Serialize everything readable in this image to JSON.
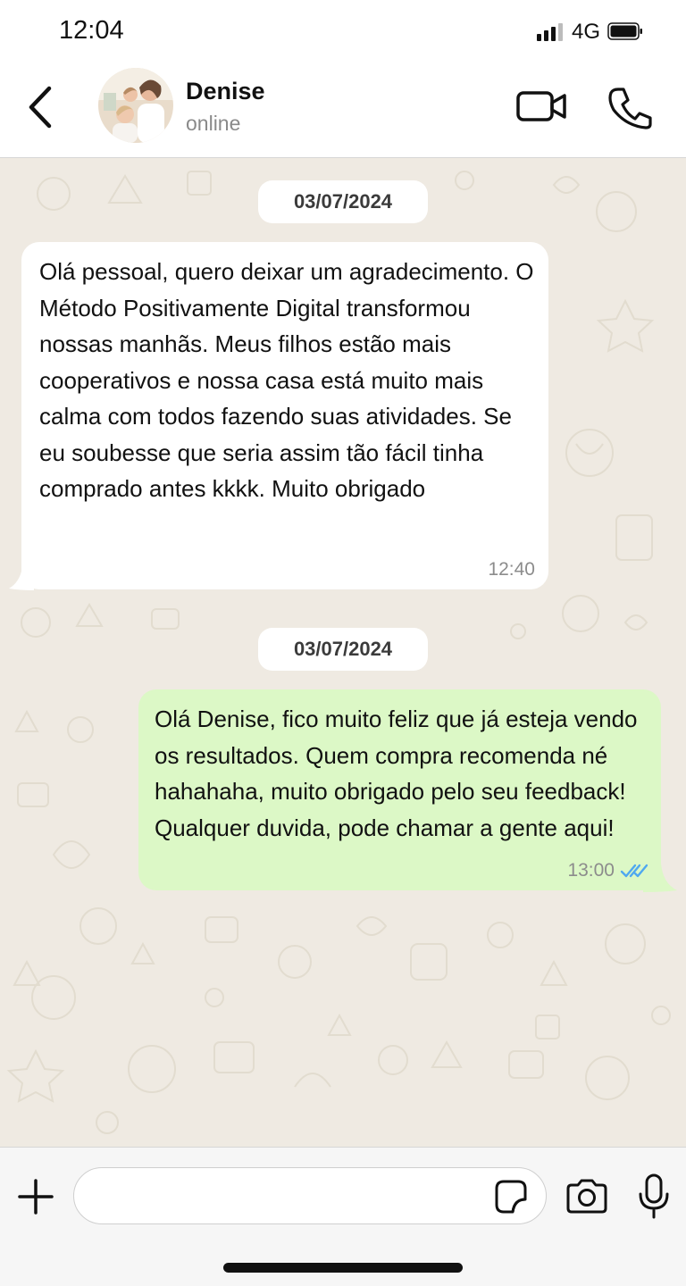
{
  "status_bar": {
    "time": "12:04",
    "network": "4G",
    "signal_icon": "signal-bars-icon",
    "battery_icon": "battery-full-icon"
  },
  "header": {
    "back_icon": "chevron-left-icon",
    "contact_name": "Denise",
    "contact_status": "online",
    "video_icon": "video-camera-icon",
    "call_icon": "phone-icon"
  },
  "messages": [
    {
      "date_label": "03/07/2024",
      "direction": "incoming",
      "text": "Olá pessoal, quero deixar um agradecimento. O Método Positivamente Digital transformou nossas manhãs. Meus filhos estão mais cooperativos e nossa casa está muito mais calma com todos fazendo suas atividades. Se eu soubesse que seria assim tão fácil tinha comprado antes kkkk. Muito obrigado",
      "time": "12:40"
    },
    {
      "date_label": "03/07/2024",
      "direction": "outgoing",
      "text": "Olá Denise, fico muito feliz que já esteja vendo os resultados. Quem compra recomenda né hahahaha, muito obrigado pelo seu feedback! Qualquer duvida, pode chamar a gente aqui!",
      "time": "13:00",
      "status": "read"
    }
  ],
  "input_bar": {
    "message_value": "",
    "plus_icon": "plus-icon",
    "sticker_icon": "sticker-icon",
    "camera_icon": "camera-icon",
    "mic_icon": "microphone-icon"
  },
  "colors": {
    "chat_background": "#efeae2",
    "incoming_bubble": "#ffffff",
    "outgoing_bubble": "#dcf8c6",
    "read_ticks": "#4fa8f0"
  }
}
